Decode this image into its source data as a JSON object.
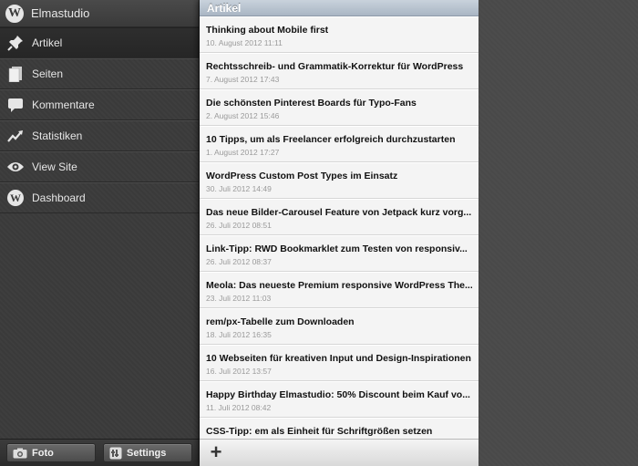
{
  "sidebar": {
    "site_name": "Elmastudio",
    "items": [
      {
        "label": "Artikel",
        "icon": "pin-icon",
        "active": true
      },
      {
        "label": "Seiten",
        "icon": "pages-icon",
        "active": false
      },
      {
        "label": "Kommentare",
        "icon": "comment-icon",
        "active": false
      },
      {
        "label": "Statistiken",
        "icon": "stats-icon",
        "active": false
      },
      {
        "label": "View Site",
        "icon": "eye-icon",
        "active": false
      },
      {
        "label": "Dashboard",
        "icon": "wordpress-icon",
        "active": false
      }
    ],
    "bottom": {
      "photo_label": "Foto",
      "settings_label": "Settings"
    }
  },
  "panel": {
    "title": "Artikel",
    "posts": [
      {
        "title": "Thinking about Mobile first",
        "date": "10. August 2012 11:11"
      },
      {
        "title": "Rechtsschreib- und Grammatik-Korrektur für WordPress",
        "date": "7. August 2012 17:43"
      },
      {
        "title": "Die schönsten Pinterest Boards für Typo-Fans",
        "date": "2. August 2012 15:46"
      },
      {
        "title": "10 Tipps, um als Freelancer erfolgreich durchzustarten",
        "date": "1. August 2012 17:27"
      },
      {
        "title": "WordPress Custom Post Types im Einsatz",
        "date": "30. Juli 2012 14:49"
      },
      {
        "title": "Das neue Bilder-Carousel Feature von Jetpack kurz vorg...",
        "date": "26. Juli 2012 08:51"
      },
      {
        "title": "Link-Tipp: RWD Bookmarklet zum Testen von responsiv...",
        "date": "26. Juli 2012 08:37"
      },
      {
        "title": "Meola: Das neueste Premium responsive WordPress The...",
        "date": "23. Juli 2012 11:03"
      },
      {
        "title": "rem/px-Tabelle zum Downloaden",
        "date": "18. Juli 2012 16:35"
      },
      {
        "title": "10 Webseiten für kreativen Input und Design-Inspirationen",
        "date": "16. Juli 2012 13:57"
      },
      {
        "title": "Happy Birthday Elmastudio: 50% Discount beim Kauf vo...",
        "date": "11. Juli 2012 08:42"
      },
      {
        "title": "CSS-Tipp: em als Einheit für Schriftgrößen setzen",
        "date": ""
      }
    ],
    "add_label": "+"
  }
}
